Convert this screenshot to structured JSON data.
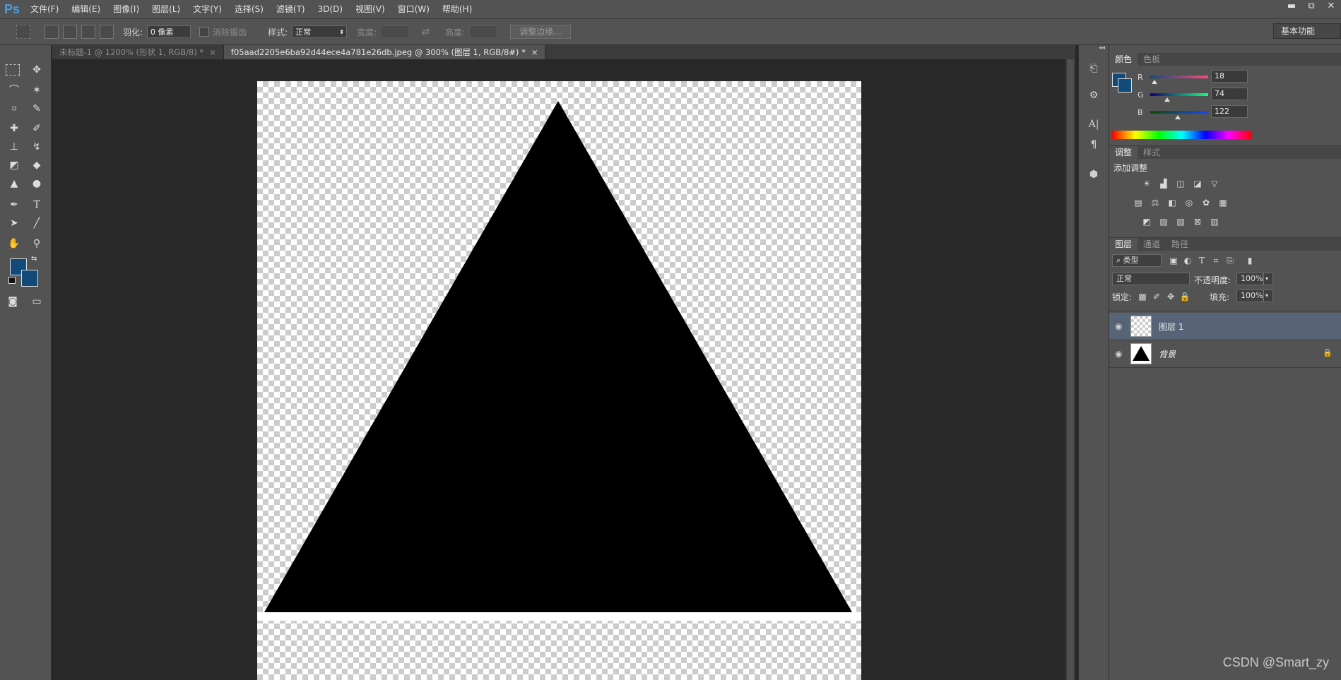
{
  "app": {
    "logo": "Ps",
    "workspace": "基本功能"
  },
  "menu": [
    "文件(F)",
    "编辑(E)",
    "图像(I)",
    "图层(L)",
    "文字(Y)",
    "选择(S)",
    "滤镜(T)",
    "3D(D)",
    "视图(V)",
    "窗口(W)",
    "帮助(H)"
  ],
  "window_controls": {
    "minimize": "▬",
    "restore": "⧉",
    "close": "✕"
  },
  "options": {
    "feather_label": "羽化:",
    "feather_value": "0 像素",
    "antialias_label": "消除锯齿",
    "style_label": "样式:",
    "style_value": "正常",
    "width_label": "宽度:",
    "height_label": "高度:",
    "refine_edge": "调整边缘..."
  },
  "tabs": [
    {
      "title": "未标题-1 @ 1200% (形状 1, RGB/8) *",
      "close": "×"
    },
    {
      "title": "f05aad2205e6ba92d44ece4a781e26db.jpeg @ 300% (图层 1, RGB/8#) *",
      "close": "×"
    }
  ],
  "colors": {
    "foreground": "#124a7a",
    "background": "#124a7a",
    "triangle": "#000000"
  },
  "color_panel": {
    "tabs": [
      "颜色",
      "色板"
    ],
    "channels": [
      {
        "label": "R",
        "value": "18",
        "fraction": 0.07
      },
      {
        "label": "G",
        "value": "74",
        "fraction": 0.29
      },
      {
        "label": "B",
        "value": "122",
        "fraction": 0.48
      }
    ]
  },
  "adjust_panel": {
    "tabs": [
      "调整",
      "样式"
    ],
    "title": "添加调整"
  },
  "layers_panel": {
    "tabs": [
      "图层",
      "通道",
      "路径"
    ],
    "filter_kind": "类型",
    "blend_mode": "正常",
    "opacity_label": "不透明度:",
    "opacity_value": "100%",
    "lock_label": "锁定:",
    "fill_label": "填充:",
    "fill_value": "100%",
    "layers": [
      {
        "name": "图层 1",
        "selected": true
      },
      {
        "name": "背景",
        "selected": false
      }
    ]
  },
  "watermark": "CSDN @Smart_zy"
}
